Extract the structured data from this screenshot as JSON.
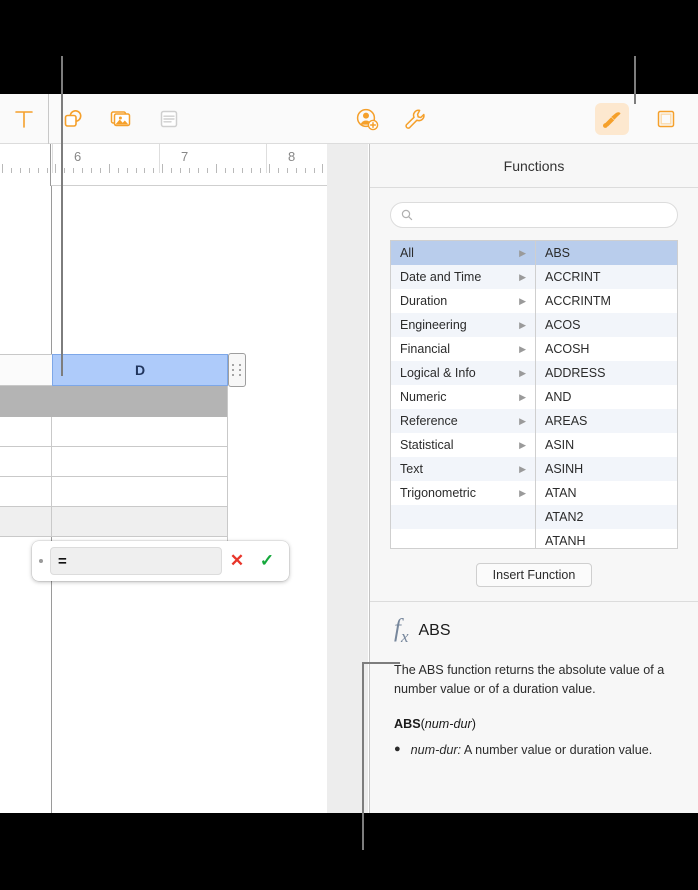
{
  "toolbar": {
    "items": [
      {
        "name": "text-tool",
        "icon": "text-T-icon",
        "label": "Text",
        "state": "enabled"
      },
      {
        "name": "shape-tool",
        "icon": "shape-icon",
        "label": "Shape",
        "state": "enabled"
      },
      {
        "name": "media-tool",
        "icon": "media-image-icon",
        "label": "Media",
        "state": "enabled"
      },
      {
        "name": "table-tool",
        "icon": "table-icon",
        "label": "Table",
        "state": "disabled"
      },
      {
        "name": "collaborate-tool",
        "icon": "add-person-icon",
        "label": "Collaborate",
        "state": "enabled"
      },
      {
        "name": "tools-tool",
        "icon": "wrench-icon",
        "label": "Tools",
        "state": "enabled"
      },
      {
        "name": "format-tool",
        "icon": "paintbrush-icon",
        "label": "Format",
        "state": "selected"
      },
      {
        "name": "document-tool",
        "icon": "document-icon",
        "label": "Document",
        "state": "enabled"
      }
    ]
  },
  "ruler": {
    "numbers": [
      "6",
      "7",
      "8"
    ]
  },
  "sheet": {
    "selected_column_label": "D",
    "formula_editor": {
      "value": "=",
      "placeholder": "",
      "cancel_label": "✕",
      "accept_label": "✓"
    }
  },
  "panel": {
    "title": "Functions",
    "search": {
      "value": "",
      "placeholder": "",
      "icon": "search-icon"
    },
    "categories": [
      {
        "label": "All",
        "selected": true
      },
      {
        "label": "Date and Time",
        "selected": false
      },
      {
        "label": "Duration",
        "selected": false
      },
      {
        "label": "Engineering",
        "selected": false
      },
      {
        "label": "Financial",
        "selected": false
      },
      {
        "label": "Logical & Info",
        "selected": false
      },
      {
        "label": "Numeric",
        "selected": false
      },
      {
        "label": "Reference",
        "selected": false
      },
      {
        "label": "Statistical",
        "selected": false
      },
      {
        "label": "Text",
        "selected": false
      },
      {
        "label": "Trigonometric",
        "selected": false
      }
    ],
    "functions": [
      {
        "label": "ABS",
        "selected": true
      },
      {
        "label": "ACCRINT",
        "selected": false
      },
      {
        "label": "ACCRINTM",
        "selected": false
      },
      {
        "label": "ACOS",
        "selected": false
      },
      {
        "label": "ACOSH",
        "selected": false
      },
      {
        "label": "ADDRESS",
        "selected": false
      },
      {
        "label": "AND",
        "selected": false
      },
      {
        "label": "AREAS",
        "selected": false
      },
      {
        "label": "ASIN",
        "selected": false
      },
      {
        "label": "ASINH",
        "selected": false
      },
      {
        "label": "ATAN",
        "selected": false
      },
      {
        "label": "ATAN2",
        "selected": false
      },
      {
        "label": "ATANH",
        "selected": false
      }
    ],
    "insert_button_label": "Insert Function",
    "detail": {
      "fx_icon": "fx-icon",
      "name": "ABS",
      "description": "The ABS function returns the absolute value of a number value or of a duration value.",
      "signature_name": "ABS",
      "signature_open": "(",
      "signature_arg": "num-dur",
      "signature_close": ")",
      "argument_name": "num-dur:",
      "argument_desc": "A number value or duration value."
    }
  },
  "colors": {
    "accent_orange": "#f5a02b",
    "selection_blue": "#aecbfa",
    "list_selection": "#b9cdec",
    "cancel_red": "#e8352a",
    "accept_green": "#15a83c"
  }
}
